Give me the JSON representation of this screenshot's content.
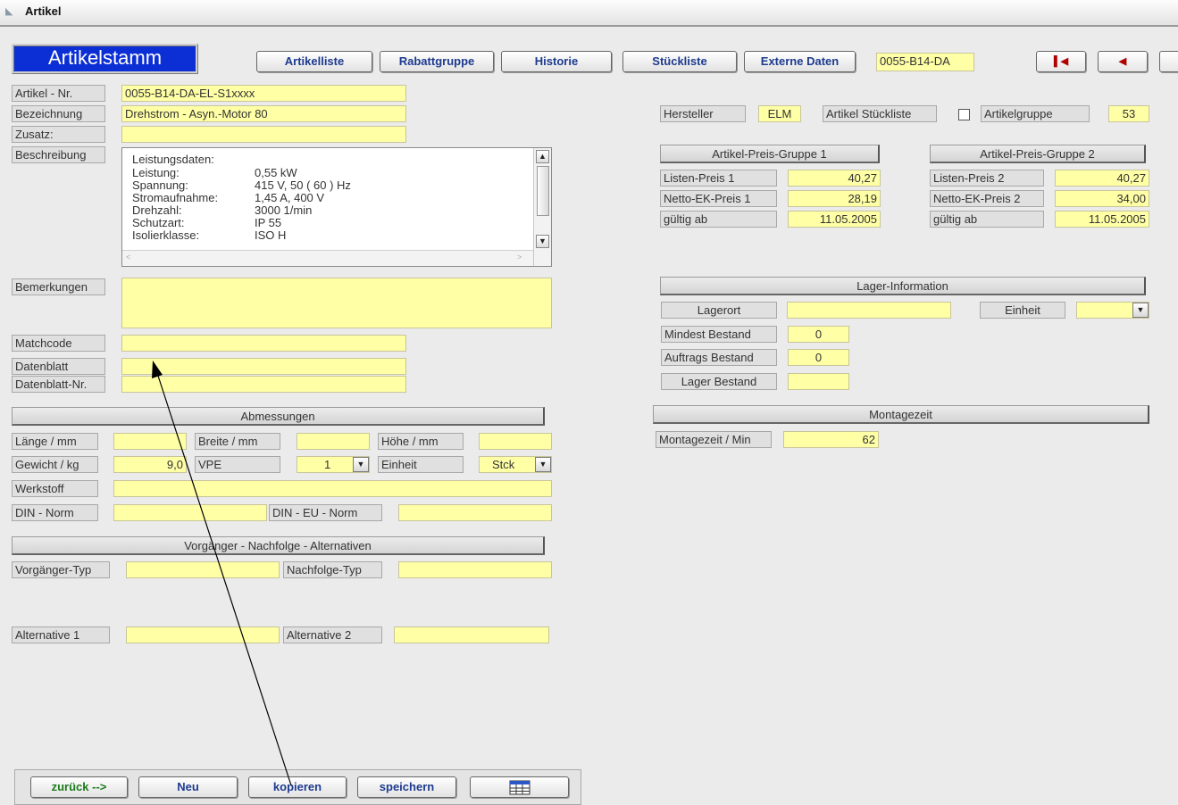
{
  "window": {
    "title": "Artikel"
  },
  "header": {
    "form_title": "Artikelstamm",
    "buttons": [
      "Artikelliste",
      "Rabattgruppe",
      "Historie",
      "Stückliste",
      "Externe Daten"
    ],
    "current_article": "0055-B14-DA"
  },
  "left": {
    "artikel_nr": {
      "label": "Artikel - Nr.",
      "value": "0055-B14-DA-EL-S1xxxx"
    },
    "bezeichnung": {
      "label": "Bezeichnung",
      "value": "Drehstrom - Asyn.-Motor 80"
    },
    "zusatz": {
      "label": "Zusatz:",
      "value": ""
    },
    "beschreibung": {
      "label": "Beschreibung",
      "heading": "Leistungsdaten:",
      "rows": [
        {
          "k": "Leistung:",
          "v": "0,55 kW"
        },
        {
          "k": "Spannung:",
          "v": "415 V, 50 ( 60 ) Hz"
        },
        {
          "k": "Stromaufnahme:",
          "v": "1,45 A, 400 V"
        },
        {
          "k": "Drehzahl:",
          "v": "3000 1/min"
        },
        {
          "k": "Schutzart:",
          "v": "IP 55"
        },
        {
          "k": "Isolierklasse:",
          "v": "ISO H"
        }
      ]
    },
    "bemerkungen": {
      "label": "Bemerkungen",
      "value": ""
    },
    "matchcode": {
      "label": "Matchcode",
      "value": ""
    },
    "datenblatt": {
      "label": "Datenblatt",
      "value": ""
    },
    "datenblatt_nr": {
      "label": "Datenblatt-Nr.",
      "value": ""
    }
  },
  "abmessungen": {
    "title": "Abmessungen",
    "laenge": {
      "label": "Länge / mm",
      "value": ""
    },
    "breite": {
      "label": "Breite / mm",
      "value": ""
    },
    "hoehe": {
      "label": "Höhe / mm",
      "value": ""
    },
    "gewicht": {
      "label": "Gewicht / kg",
      "value": "9,0"
    },
    "vpe": {
      "label": "VPE",
      "value": "1"
    },
    "einheit": {
      "label": "Einheit",
      "value": "Stck"
    },
    "werkstoff": {
      "label": "Werkstoff",
      "value": ""
    },
    "din": {
      "label": "DIN - Norm",
      "value": ""
    },
    "din_eu": {
      "label": "DIN - EU - Norm",
      "value": ""
    }
  },
  "nachfolge": {
    "title": "Vorgänger - Nachfolge - Alternativen",
    "vorgaenger": {
      "label": "Vorgänger-Typ",
      "value": ""
    },
    "nachfolge": {
      "label": "Nachfolge-Typ",
      "value": ""
    },
    "alt1": {
      "label": "Alternative 1",
      "value": ""
    },
    "alt2": {
      "label": "Alternative 2",
      "value": ""
    }
  },
  "right": {
    "hersteller": {
      "label": "Hersteller",
      "value": "ELM"
    },
    "stueckliste": {
      "label": "Artikel Stückliste",
      "checked": false
    },
    "artikelgruppe": {
      "label": "Artikelgruppe",
      "value": "53"
    },
    "preis1": {
      "title": "Artikel-Preis-Gruppe 1",
      "listen": {
        "label": "Listen-Preis 1",
        "value": "40,27"
      },
      "netto": {
        "label": "Netto-EK-Preis 1",
        "value": "28,19"
      },
      "gueltig": {
        "label": "gültig ab",
        "value": "11.05.2005"
      }
    },
    "preis2": {
      "title": "Artikel-Preis-Gruppe 2",
      "listen": {
        "label": "Listen-Preis 2",
        "value": "40,27"
      },
      "netto": {
        "label": "Netto-EK-Preis 2",
        "value": "34,00"
      },
      "gueltig": {
        "label": "gültig ab",
        "value": "11.05.2005"
      }
    },
    "lager": {
      "title": "Lager-Information",
      "lagerort": {
        "label": "Lagerort",
        "value": ""
      },
      "einheit": {
        "label": "Einheit",
        "value": ""
      },
      "mindest": {
        "label": "Mindest Bestand",
        "value": "0"
      },
      "auftrags": {
        "label": "Auftrags Bestand",
        "value": "0"
      },
      "bestand": {
        "label": "Lager Bestand",
        "value": ""
      }
    },
    "montage": {
      "title": "Montagezeit",
      "zeit": {
        "label": "Montagezeit / Min",
        "value": "62"
      }
    }
  },
  "footer": {
    "zurueck": "zurück -->",
    "neu": "Neu",
    "kopieren": "kopieren",
    "speichern": "speichern"
  }
}
